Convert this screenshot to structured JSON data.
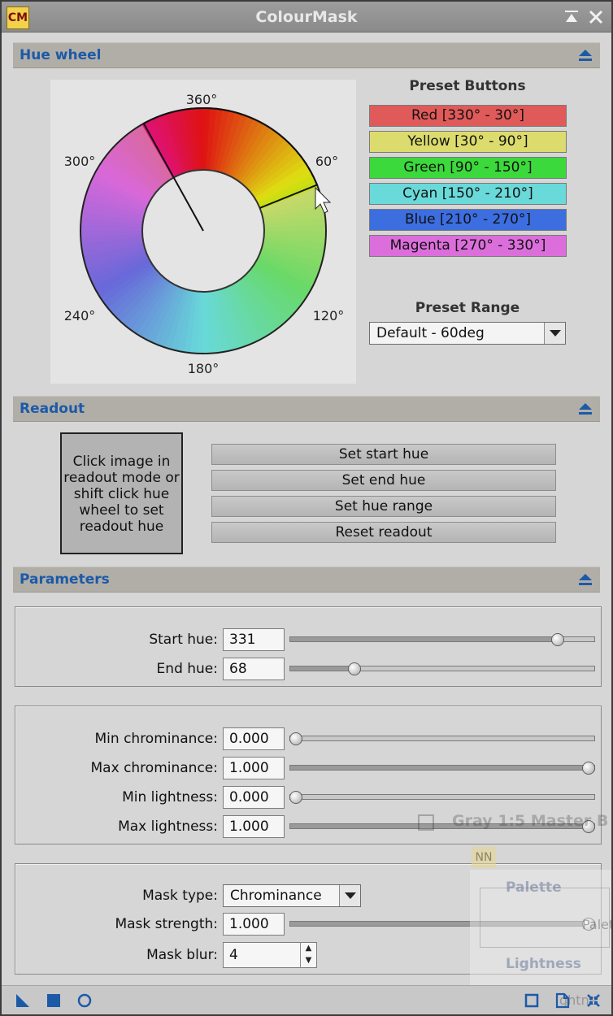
{
  "window": {
    "title": "ColourMask",
    "app_icon_text": "CM"
  },
  "hue_wheel": {
    "section_title": "Hue wheel",
    "angle_labels": {
      "top": "360°",
      "ne": "60°",
      "se": "120°",
      "bottom": "180°",
      "sw": "240°",
      "nw": "300°"
    },
    "preset_heading": "Preset Buttons",
    "presets": [
      {
        "label": "Red [330° - 30°]",
        "color": "#e05a5a"
      },
      {
        "label": "Yellow [30° - 90°]",
        "color": "#dcdc6e"
      },
      {
        "label": "Green [90° - 150°]",
        "color": "#3cd93c"
      },
      {
        "label": "Cyan [150° - 210°]",
        "color": "#6ad9d9"
      },
      {
        "label": "Blue [210° - 270°]",
        "color": "#3c6ee0"
      },
      {
        "label": "Magenta [270° - 330°]",
        "color": "#dc6edc"
      }
    ],
    "range_label": "Preset Range",
    "range_value": "Default - 60deg"
  },
  "readout": {
    "section_title": "Readout",
    "info_line1": "Click image in",
    "info_line2": "readout mode or",
    "info_line3": "shift click hue",
    "info_line4": "wheel to set",
    "info_line5": "readout hue",
    "buttons": {
      "set_start": "Set start hue",
      "set_end": "Set end hue",
      "set_range": "Set hue range",
      "reset": "Reset readout"
    }
  },
  "parameters": {
    "section_title": "Parameters",
    "start_hue": {
      "label": "Start hue:",
      "value": "331",
      "level": 0.895
    },
    "end_hue": {
      "label": "End hue:",
      "value": "68",
      "level": 0.2
    },
    "min_chrominance": {
      "label": "Min chrominance:",
      "value": "0.000",
      "level": 0.0
    },
    "max_chrominance": {
      "label": "Max chrominance:",
      "value": "1.000",
      "level": 1.0
    },
    "min_lightness": {
      "label": "Min lightness:",
      "value": "0.000",
      "level": 0.0
    },
    "max_lightness": {
      "label": "Max lightness:",
      "value": "1.000",
      "level": 1.0
    },
    "mask_type": {
      "label": "Mask type:",
      "value": "Chrominance"
    },
    "mask_strength": {
      "label": "Mask strength:",
      "value": "1.000",
      "level": 1.0
    },
    "mask_blur": {
      "label": "Mask blur:",
      "value": "4"
    }
  },
  "background_window": {
    "title": "Gray 1:5 Master B",
    "icon_text": "NN",
    "palette": "Palette",
    "lightness": "Lightness",
    "fragment1": "Palet",
    "fragment2": "ghtne"
  }
}
